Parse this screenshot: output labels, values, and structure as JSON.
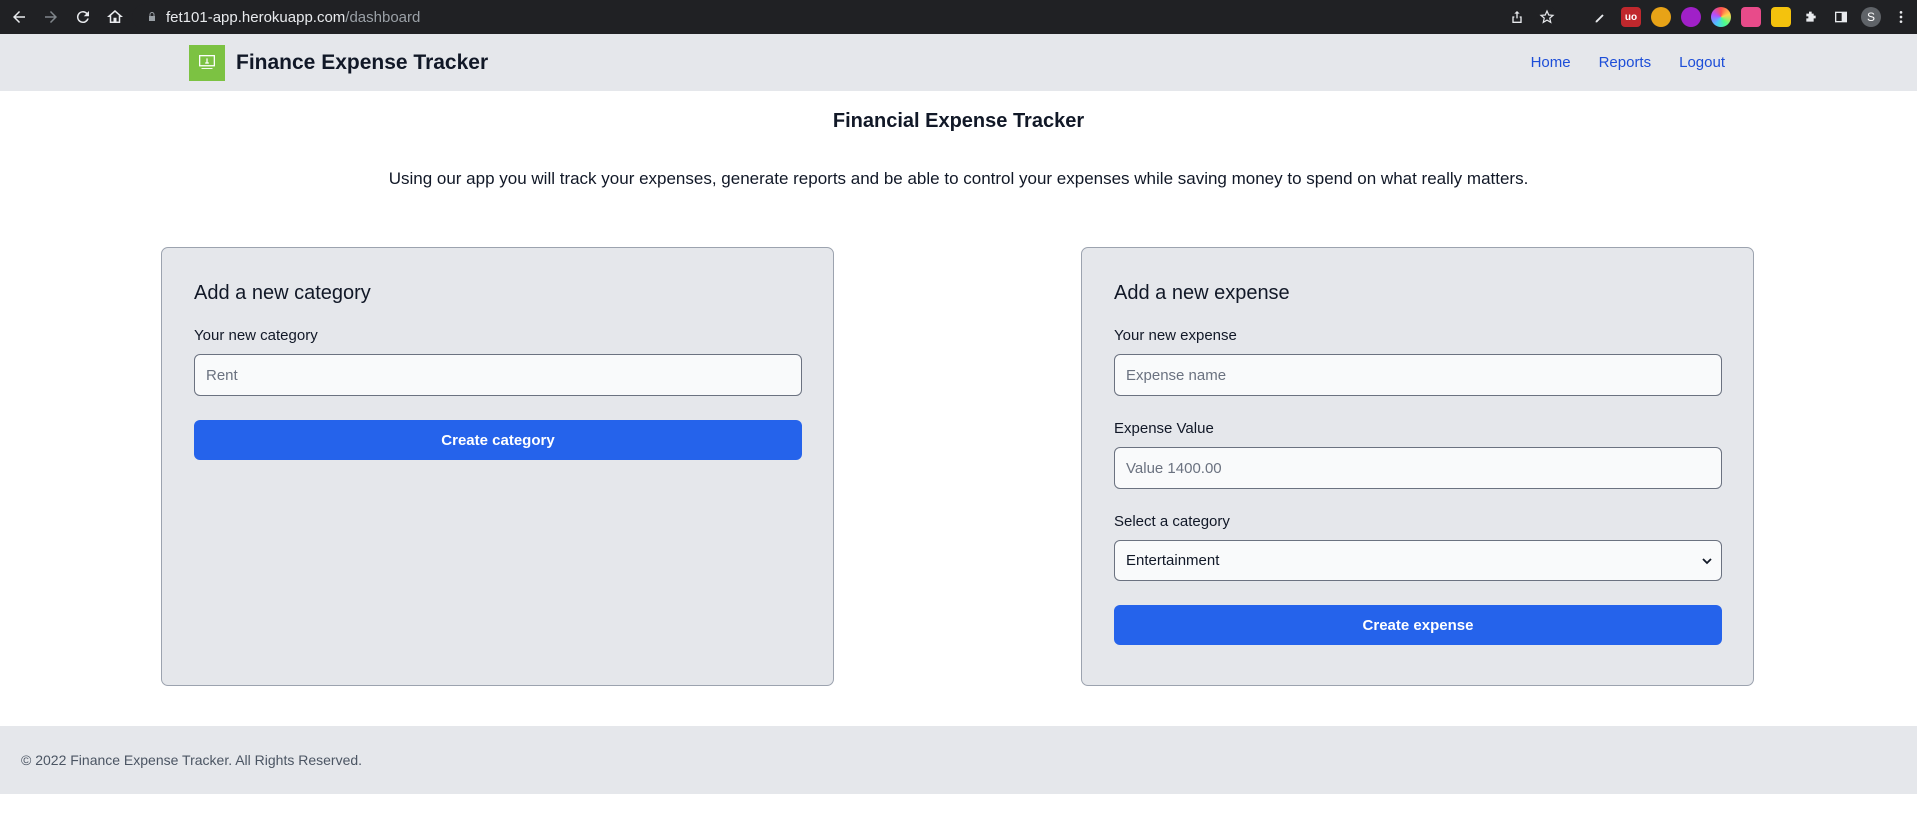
{
  "browser": {
    "url_host": "fet101-app.herokuapp.com",
    "url_path": "/dashboard",
    "profile_initial": "S"
  },
  "header": {
    "brand": "Finance Expense Tracker",
    "nav": [
      {
        "label": "Home"
      },
      {
        "label": "Reports"
      },
      {
        "label": "Logout"
      }
    ]
  },
  "main": {
    "title": "Financial Expense Tracker",
    "intro": "Using our app you will track your expenses, generate reports and be able to control your expenses while saving money to spend on what really matters."
  },
  "category_form": {
    "heading": "Add a new category",
    "field_label": "Your new category",
    "field_placeholder": "Rent",
    "field_value": "",
    "submit_label": "Create category"
  },
  "expense_form": {
    "heading": "Add a new expense",
    "name_label": "Your new expense",
    "name_placeholder": "Expense name",
    "value_label": "Expense Value",
    "value_placeholder": "Value 1400.00",
    "category_label": "Select a category",
    "category_selected": "Entertainment",
    "submit_label": "Create expense"
  },
  "footer": {
    "text": "© 2022 Finance Expense Tracker. All Rights Reserved."
  },
  "colors": {
    "primary": "#2563eb",
    "link": "#1d4ed8",
    "panel": "#e5e7eb",
    "logo": "#7cc242"
  }
}
